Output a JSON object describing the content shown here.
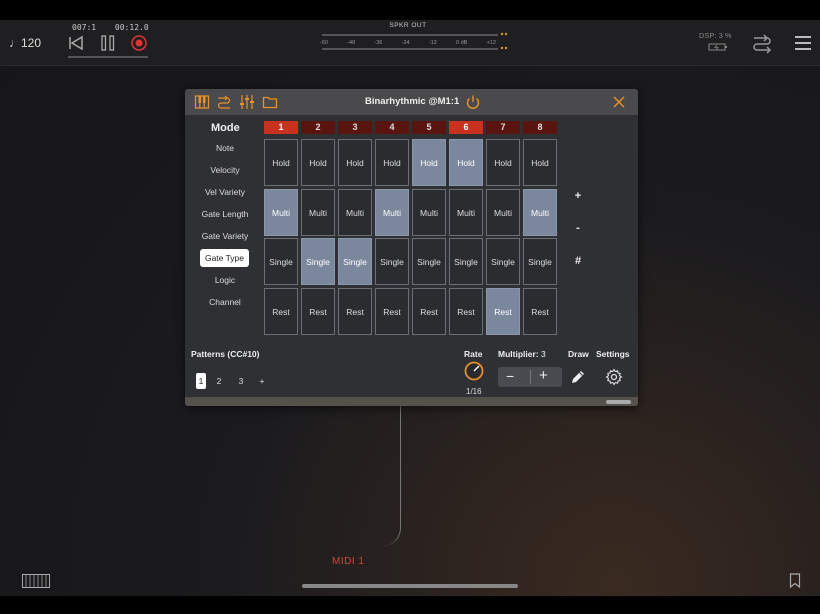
{
  "toolbar": {
    "bpm": "♩120",
    "position": "007:1",
    "time": "00:12.0",
    "meter_label": "SPKR OUT",
    "meter_scale": [
      "-60",
      "-48",
      "-36",
      "-24",
      "-12",
      "0 dB",
      "+12"
    ],
    "dsp": "DSP: 3 %"
  },
  "panel": {
    "title": "Binarhythmic @M1:1",
    "mode_title": "Mode",
    "modes": [
      "Note",
      "Velocity",
      "Vel Variety",
      "Gate Length",
      "Gate Variety",
      "Gate Type",
      "Logic",
      "Channel"
    ],
    "selected_mode": "Gate Type",
    "columns": [
      "1",
      "2",
      "3",
      "4",
      "5",
      "6",
      "7",
      "8"
    ],
    "active_columns": [
      0,
      5
    ],
    "rows": [
      "Hold",
      "Multi",
      "Single",
      "Rest"
    ],
    "grid_on": [
      [
        false,
        false,
        false,
        false,
        true,
        true,
        false,
        false
      ],
      [
        true,
        false,
        false,
        true,
        false,
        false,
        false,
        true
      ],
      [
        false,
        true,
        true,
        false,
        false,
        false,
        false,
        false
      ],
      [
        false,
        false,
        false,
        false,
        false,
        false,
        true,
        false
      ]
    ],
    "side_buttons": [
      "+",
      "-",
      "#"
    ],
    "patterns_label": "Patterns (CC#10)",
    "patterns": [
      "1",
      "2",
      "3",
      "+"
    ],
    "selected_pattern": "1",
    "rate_label": "Rate",
    "rate_value": "1/16",
    "multiplier_label": "Multiplier:",
    "multiplier_value": "3",
    "draw_label": "Draw",
    "settings_label": "Settings"
  },
  "canvas": {
    "midi_label": "MIDI 1"
  },
  "colors": {
    "accent_orange": "#e8902a",
    "active_column_red": "#c8321f",
    "column_dark_red": "#5a1410",
    "cell_on": "#7a879c"
  }
}
